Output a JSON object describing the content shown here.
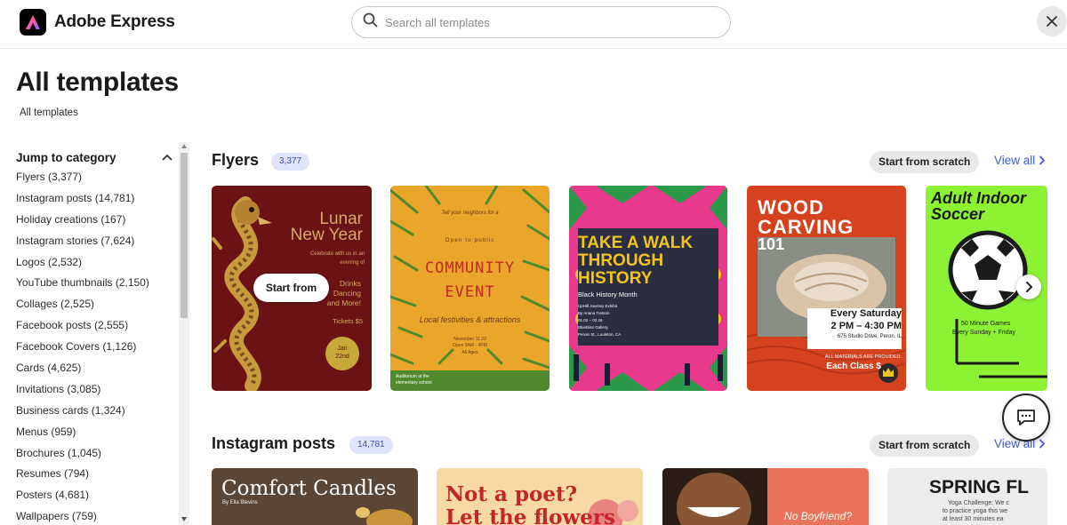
{
  "app": {
    "name": "Adobe Express"
  },
  "search": {
    "placeholder": "Search all templates"
  },
  "page": {
    "title": "All templates",
    "breadcrumb": "All templates"
  },
  "sidebar": {
    "heading": "Jump to category",
    "categories": [
      "Flyers (3,377)",
      "Instagram posts (14,781)",
      "Holiday creations (167)",
      "Instagram stories (7,624)",
      "Logos (2,532)",
      "YouTube thumbnails (2,150)",
      "Collages (2,525)",
      "Facebook posts (2,555)",
      "Facebook Covers (1,126)",
      "Cards (4,625)",
      "Invitations (3,085)",
      "Business cards (1,324)",
      "Menus (959)",
      "Brochures (1,045)",
      "Resumes (794)",
      "Posters (4,681)",
      "Wallpapers (759)"
    ]
  },
  "sections": [
    {
      "title": "Flyers",
      "count": "3,377",
      "scratch": "Start from scratch",
      "view_all": "View all",
      "start_from": "Start from",
      "cards": [
        {
          "lines": [
            "Lunar",
            "New Year",
            "Celebrate with us in an",
            "evening of",
            "Drinks",
            "Dancing",
            "and More!",
            "Tickets $5",
            "Jan",
            "22nd"
          ]
        },
        {
          "lines": [
            "Tell your neighbors for a",
            "Open to public",
            "COMMUNITY",
            "EVENT",
            "Local festivities & attractions",
            "November 11 23",
            "Open 9AM - 4PM",
            "All Ages",
            "Auditorium at the",
            "elementary school"
          ]
        },
        {
          "lines": [
            "TAKE A WALK",
            "THROUGH",
            "HISTORY",
            "Black History Month",
            "UpHill Journey Exhibit",
            "By Ariana Tretson",
            "01.02 – 02.26",
            "Bluebliss Gallery,",
            "Peroin St., Louleton, CA"
          ]
        },
        {
          "lines": [
            "WOOD",
            "CARVING",
            "101",
            "Every Saturday",
            "2 PM – 4:30 PM",
            "675 Studio Drive, Peron, IL",
            "ALL MATERIALS ARE PROVIDED.",
            "Each Class $"
          ]
        },
        {
          "lines": [
            "Adult Indoor",
            "Soccer",
            "50 Minute Games",
            "Every Sunday + Friday"
          ]
        }
      ]
    },
    {
      "title": "Instagram posts",
      "count": "14,781",
      "scratch": "Start from scratch",
      "view_all": "View all",
      "cards": [
        {
          "lines": [
            "Comfort Candles",
            "By Ella Blevins"
          ]
        },
        {
          "lines": [
            "Not a poet?",
            "Let the flowers"
          ]
        },
        {
          "lines": [
            "No Boyfriend?"
          ]
        },
        {
          "lines": [
            "SPRING FL",
            "Yoga Challenge: We c",
            "to practice yoga this we",
            "at least 30 minutes ea"
          ]
        }
      ]
    }
  ],
  "colors": {
    "accent": "#3d5bd9",
    "badge_bg": "#e0e4fb",
    "badge_text": "#3d4fb8"
  },
  "icons": [
    "adobe-express-logo-icon",
    "search-icon",
    "close-icon",
    "chevron-up-icon",
    "chevron-right-icon",
    "next-arrow-icon",
    "chat-icon",
    "crown-icon"
  ]
}
